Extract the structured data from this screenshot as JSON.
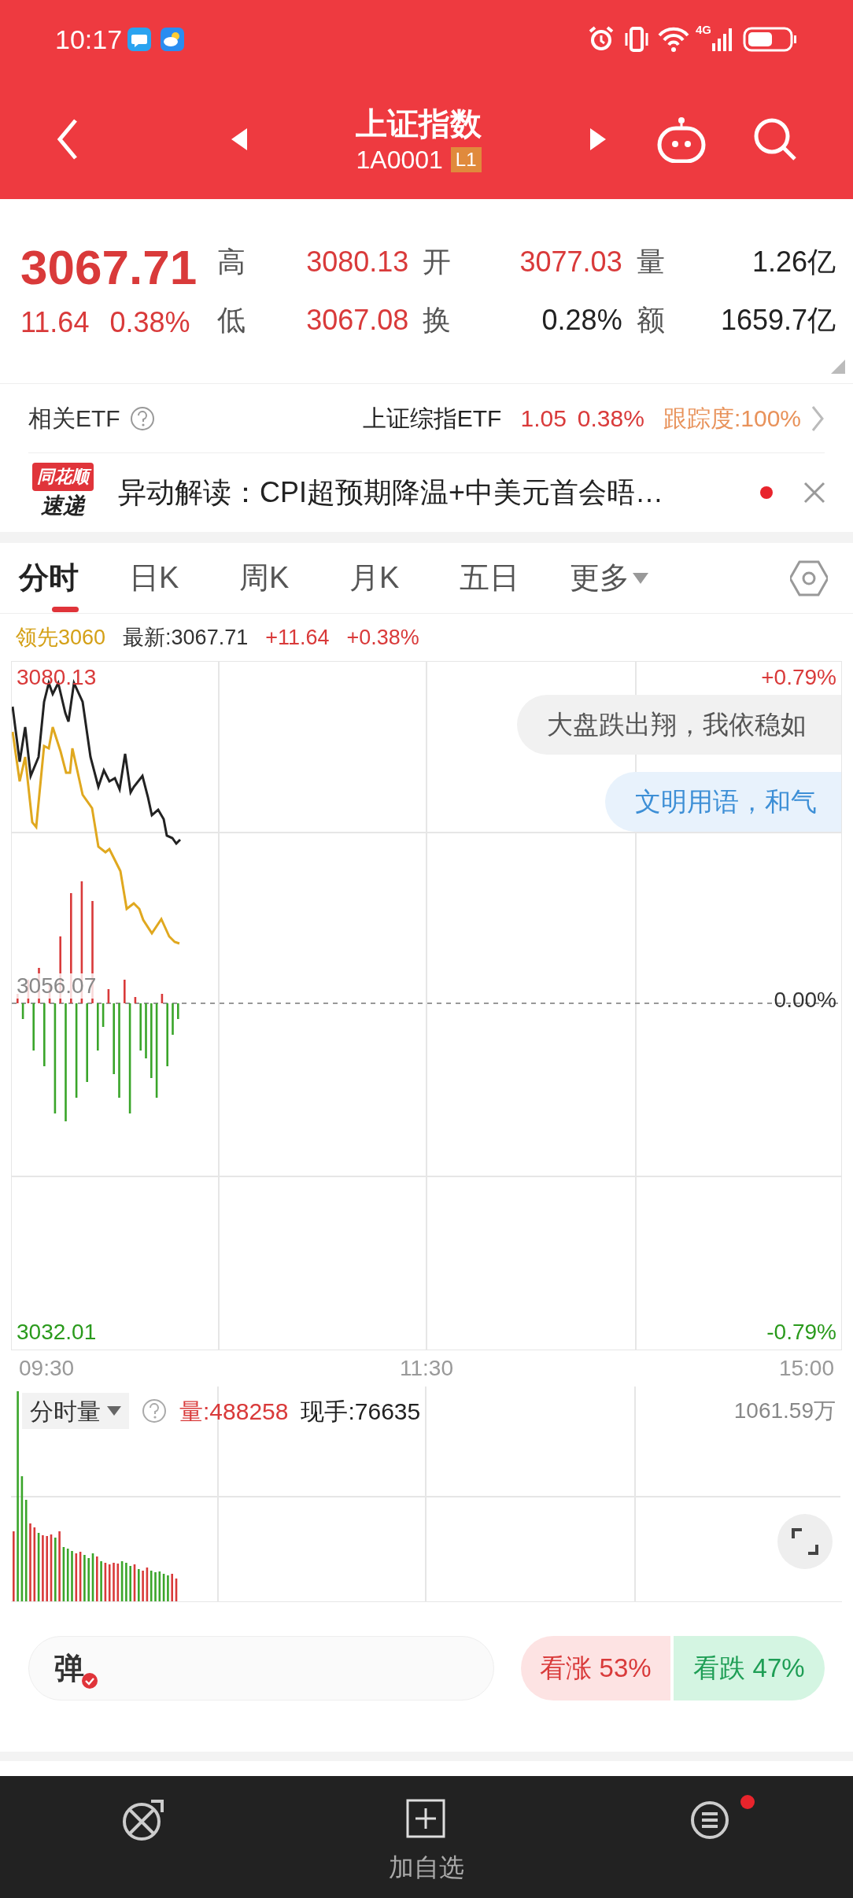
{
  "status_bar": {
    "time": "10:17",
    "network": "4G"
  },
  "header": {
    "title": "上证指数",
    "code": "1A0001",
    "level_badge": "L1"
  },
  "quote": {
    "price": "3067.71",
    "change": "11.64",
    "change_pct": "0.38%",
    "stats": [
      {
        "label": "高",
        "value": "3080.13",
        "color": "#d93a3a"
      },
      {
        "label": "开",
        "value": "3077.03",
        "color": "#d93a3a"
      },
      {
        "label": "量",
        "value": "1.26亿",
        "color": "#222222"
      },
      {
        "label": "低",
        "value": "3067.08",
        "color": "#d93a3a"
      },
      {
        "label": "换",
        "value": "0.28%",
        "color": "#222222"
      },
      {
        "label": "额",
        "value": "1659.7亿",
        "color": "#222222"
      }
    ]
  },
  "etf": {
    "label": "相关ETF",
    "name": "上证综指ETF",
    "price": "1.05",
    "change_pct": "0.38%",
    "tracking": "跟踪度:100%"
  },
  "news": {
    "logo_top": "同花顺",
    "logo_bottom": "速递",
    "headline": "异动解读：CPI超预期降温+中美元首会晤…",
    "unread": true
  },
  "tabs": [
    {
      "label": "分时",
      "selected": true,
      "kind": "tab"
    },
    {
      "label": "日K",
      "selected": false,
      "kind": "tab"
    },
    {
      "label": "周K",
      "selected": false,
      "kind": "tab"
    },
    {
      "label": "月K",
      "selected": false,
      "kind": "tab"
    },
    {
      "label": "五日",
      "selected": false,
      "kind": "tab"
    },
    {
      "label": "更多",
      "selected": false,
      "kind": "dropdown"
    }
  ],
  "chart_header": {
    "lead": "领先3060",
    "latest": "最新:3067.71",
    "change": "+11.64",
    "change_pct": "+0.38%"
  },
  "price_chart": {
    "high": "3080.13",
    "high_pct": "+0.79%",
    "base": "3056.07",
    "base_pct": "0.00%",
    "low": "3032.01",
    "low_pct": "-0.79%",
    "comments": [
      {
        "text": "大盘跌出翔，我依稳如",
        "kind": "plain"
      },
      {
        "text": "文明用语，和气",
        "kind": "civil"
      }
    ]
  },
  "time_axis": [
    "09:30",
    "11:30",
    "15:00"
  ],
  "volume_chart": {
    "selector": "分时量",
    "volume": "量:488258",
    "last_trade": "现手:76635",
    "max": "1061.59万"
  },
  "sentiment": {
    "danmaku_key": "弹",
    "bullish": "看涨 53%",
    "bearish": "看跌 47%"
  },
  "bottom_nav": [
    {
      "kind": "trade",
      "badge": false
    },
    {
      "kind": "add",
      "label": "加自选",
      "badge": false
    },
    {
      "kind": "menu",
      "badge": true
    }
  ]
}
